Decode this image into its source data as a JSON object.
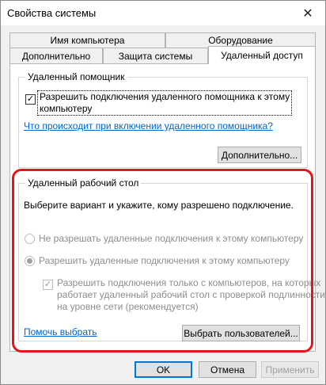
{
  "window": {
    "title": "Свойства системы",
    "close_glyph": "✕"
  },
  "tabs": {
    "row1": [
      "Имя компьютера",
      "Оборудование"
    ],
    "row2": [
      "Дополнительно",
      "Защита системы",
      "Удаленный доступ"
    ]
  },
  "remote_assistance": {
    "title": "Удаленный помощник",
    "checkbox_label_line1": "Разрешить подключения удаленного помощника к этому",
    "checkbox_label_line2": "компьютеру",
    "checked": true,
    "link": "Что происходит при включении удаленного помощника?",
    "advanced_button": "Дополнительно..."
  },
  "remote_desktop": {
    "title": "Удаленный рабочий стол",
    "prompt": "Выберите вариант и укажите, кому разрешено подключение.",
    "option_deny": "Не разрешать удаленные подключения к этому компьютеру",
    "option_allow": "Разрешить удаленные подключения к этому компьютеру",
    "selected": "allow",
    "nla_line1": "Разрешить подключения только с компьютеров, на которых",
    "nla_line2": "работает удаленный рабочий стол с проверкой подлинности",
    "nla_line3": "на уровне сети (рекомендуется)",
    "nla_checked": true,
    "help_link": "Помочь выбрать",
    "select_users_button": "Выбрать пользователей..."
  },
  "footer": {
    "ok": "OK",
    "cancel": "Отмена",
    "apply": "Применить"
  },
  "colors": {
    "highlight": "#e8141a",
    "link": "#0066cc",
    "accent": "#0078d7"
  }
}
